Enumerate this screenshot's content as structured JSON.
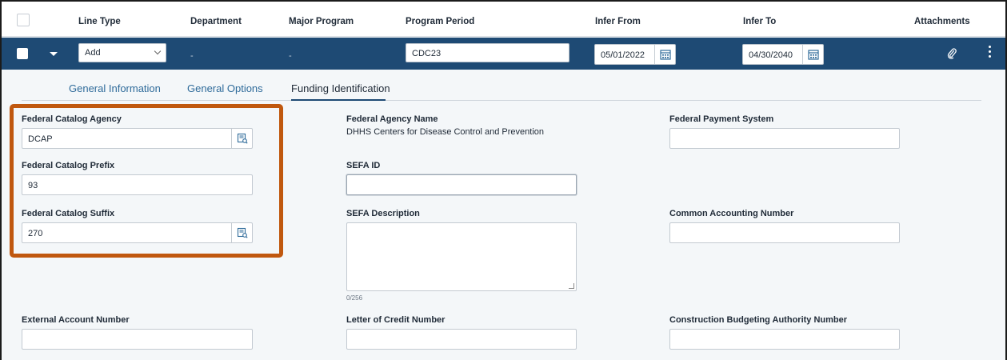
{
  "header": {
    "line_type": "Line Type",
    "department": "Department",
    "major_program": "Major Program",
    "program_period": "Program Period",
    "infer_from": "Infer From",
    "infer_to": "Infer To",
    "attachments": "Attachments"
  },
  "row": {
    "line_type_value": "Add",
    "department_value": "-",
    "major_program_value": "-",
    "program_period_value": "CDC23",
    "infer_from_value": "05/01/2022",
    "infer_to_value": "04/30/2040"
  },
  "tabs": [
    {
      "label": "General Information"
    },
    {
      "label": "General Options"
    },
    {
      "label": "Funding Identification"
    }
  ],
  "form": {
    "federal_catalog_agency": {
      "label": "Federal Catalog Agency",
      "value": "DCAP"
    },
    "federal_catalog_prefix": {
      "label": "Federal Catalog Prefix",
      "value": "93"
    },
    "federal_catalog_suffix": {
      "label": "Federal Catalog Suffix",
      "value": "270"
    },
    "federal_agency_name": {
      "label": "Federal Agency Name",
      "value": "DHHS Centers for Disease Control and Prevention"
    },
    "sefa_id": {
      "label": "SEFA ID",
      "value": ""
    },
    "sefa_description": {
      "label": "SEFA Description",
      "counter": "0/256"
    },
    "federal_payment_system": {
      "label": "Federal Payment System",
      "value": ""
    },
    "common_accounting_number": {
      "label": "Common Accounting Number",
      "value": ""
    },
    "external_account_number": {
      "label": "External Account Number",
      "value": ""
    },
    "letter_of_credit_number": {
      "label": "Letter of Credit Number",
      "value": ""
    },
    "construction_budgeting_authority_number": {
      "label": "Construction Budgeting Authority Number",
      "value": ""
    }
  },
  "colors": {
    "row_band": "#1e4a74",
    "highlight_box": "#c0580f",
    "tab_link": "#2f6b9a"
  },
  "icons": [
    "checkbox",
    "caret-down-icon",
    "chevron-down-icon",
    "calendar-icon",
    "paperclip-icon",
    "kebab-menu-icon",
    "lookup-icon"
  ]
}
